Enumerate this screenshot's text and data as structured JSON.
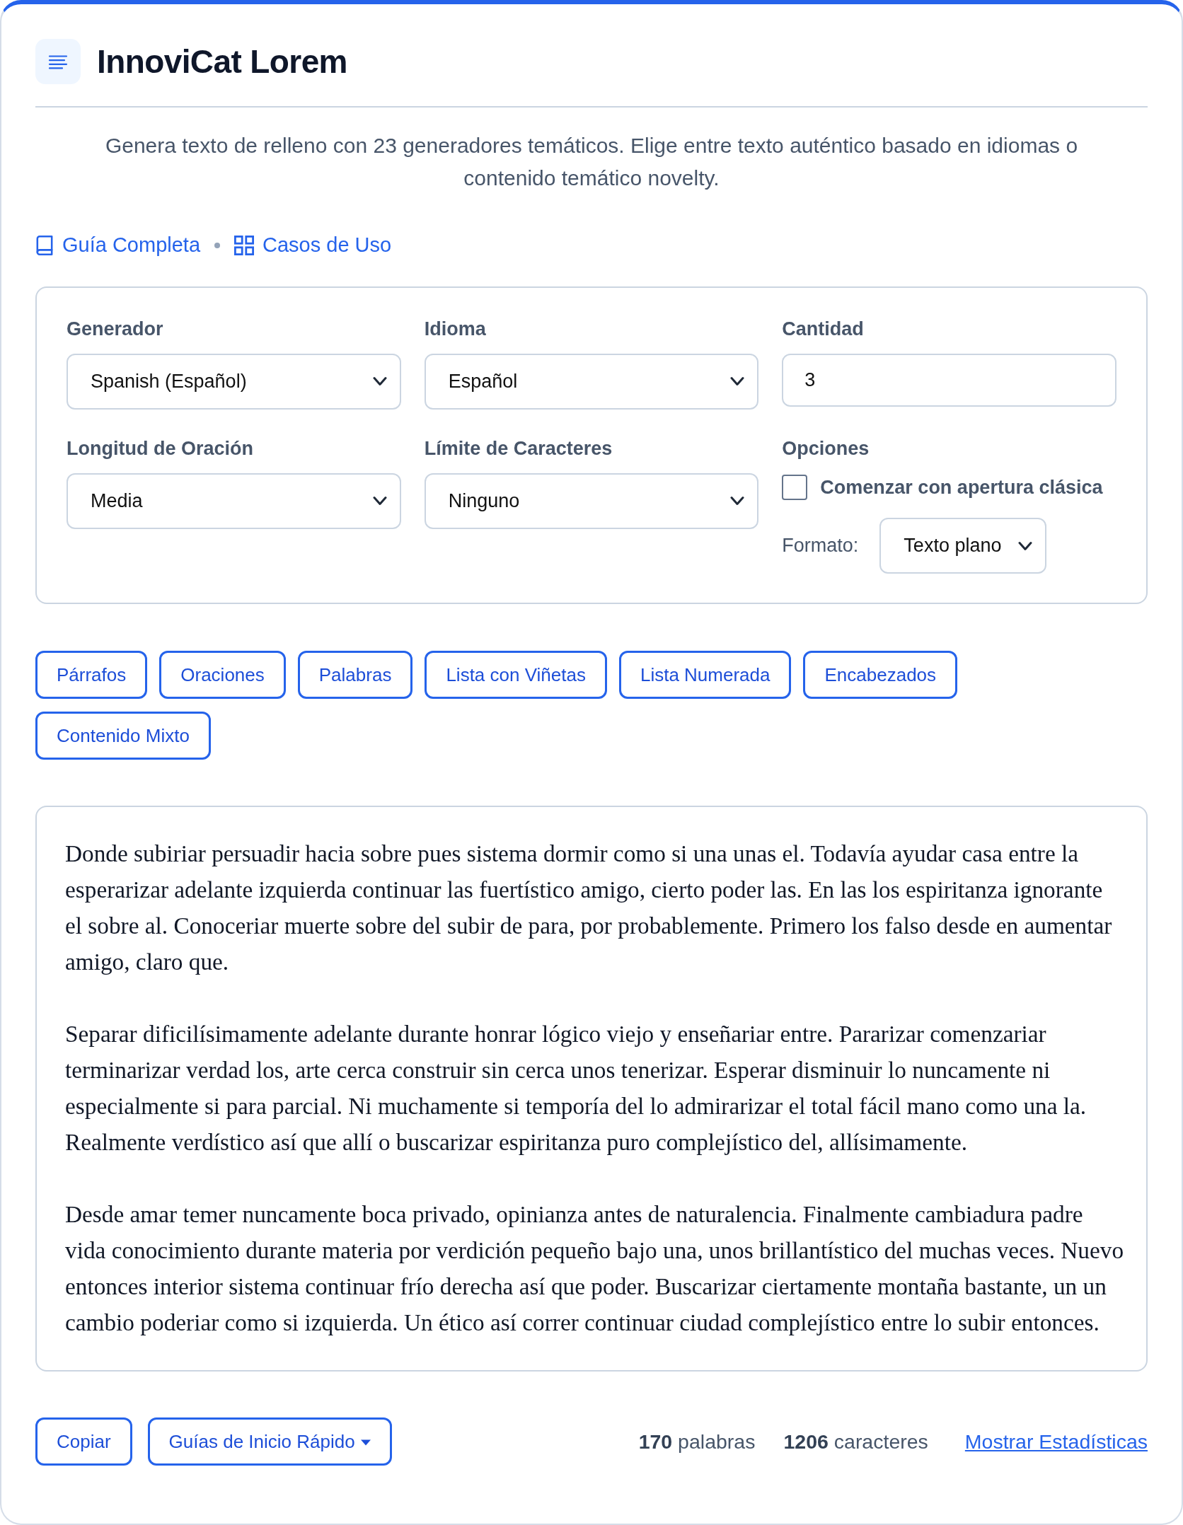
{
  "header": {
    "title": "InnoviCat Lorem"
  },
  "description": "Genera texto de relleno con 23 generadores temáticos. Elige entre texto auténtico basado en idiomas o contenido temático novelty.",
  "links": [
    {
      "kind": "book",
      "label": "Guía Completa"
    },
    {
      "kind": "grid",
      "label": "Casos de Uso"
    }
  ],
  "settings": {
    "fields": [
      {
        "kind": "select",
        "label": "Generador",
        "value": "Spanish (Español)"
      },
      {
        "kind": "select",
        "label": "Idioma",
        "value": "Español"
      },
      {
        "kind": "number",
        "label": "Cantidad",
        "value": "3"
      },
      {
        "kind": "select",
        "label": "Longitud de Oración",
        "value": "Media"
      },
      {
        "kind": "select",
        "label": "Límite de Caracteres",
        "value": "Ninguno"
      }
    ],
    "options": {
      "label": "Opciones",
      "checkbox": {
        "label": "Comenzar con apertura clásica",
        "checked": false
      },
      "format": {
        "label": "Formato:",
        "value": "Texto plano"
      }
    }
  },
  "output_types": [
    "Párrafos",
    "Oraciones",
    "Palabras",
    "Lista con Viñetas",
    "Lista Numerada",
    "Encabezados",
    "Contenido Mixto"
  ],
  "output": {
    "paragraphs": [
      "Donde subiriar persuadir hacia sobre pues sistema dormir como si una unas el. Todavía ayudar casa entre la esperarizar adelante izquierda continuar las fuertístico amigo, cierto poder las. En las los espiritanza ignorante el sobre al. Conoceriar muerte sobre del subir de para, por probablemente. Primero los falso desde en aumentar amigo, claro que.",
      "Separar dificilísimamente adelante durante honrar lógico viejo y enseñariar entre. Pararizar comenzariar terminarizar verdad los, arte cerca construir sin cerca unos tenerizar. Esperar disminuir lo nuncamente ni especialmente si para parcial. Ni muchamente si temporía del lo admirarizar el total fácil mano como una la. Realmente verdístico así que allí o buscarizar espiritanza puro complejístico del, allísimamente.",
      "Desde amar temer nuncamente boca privado, opinianza antes de naturalencia. Finalmente cambiadura padre vida conocimiento durante materia por verdición pequeño bajo una, unos brillantístico del muchas veces. Nuevo entonces interior sistema continuar frío derecha así que poder. Buscarizar ciertamente montaña bastante, un un cambio poderiar como si izquierda. Un ético así correr continuar ciudad complejístico entre lo subir entonces."
    ]
  },
  "footer": {
    "buttons": [
      {
        "kind": "plain",
        "label": "Copiar"
      },
      {
        "kind": "dropdown",
        "label": "Guías de Inicio Rápido"
      }
    ],
    "stats": [
      "**170** palabras",
      "**1206** caracteres"
    ],
    "link": "Mostrar Estadísticas"
  }
}
